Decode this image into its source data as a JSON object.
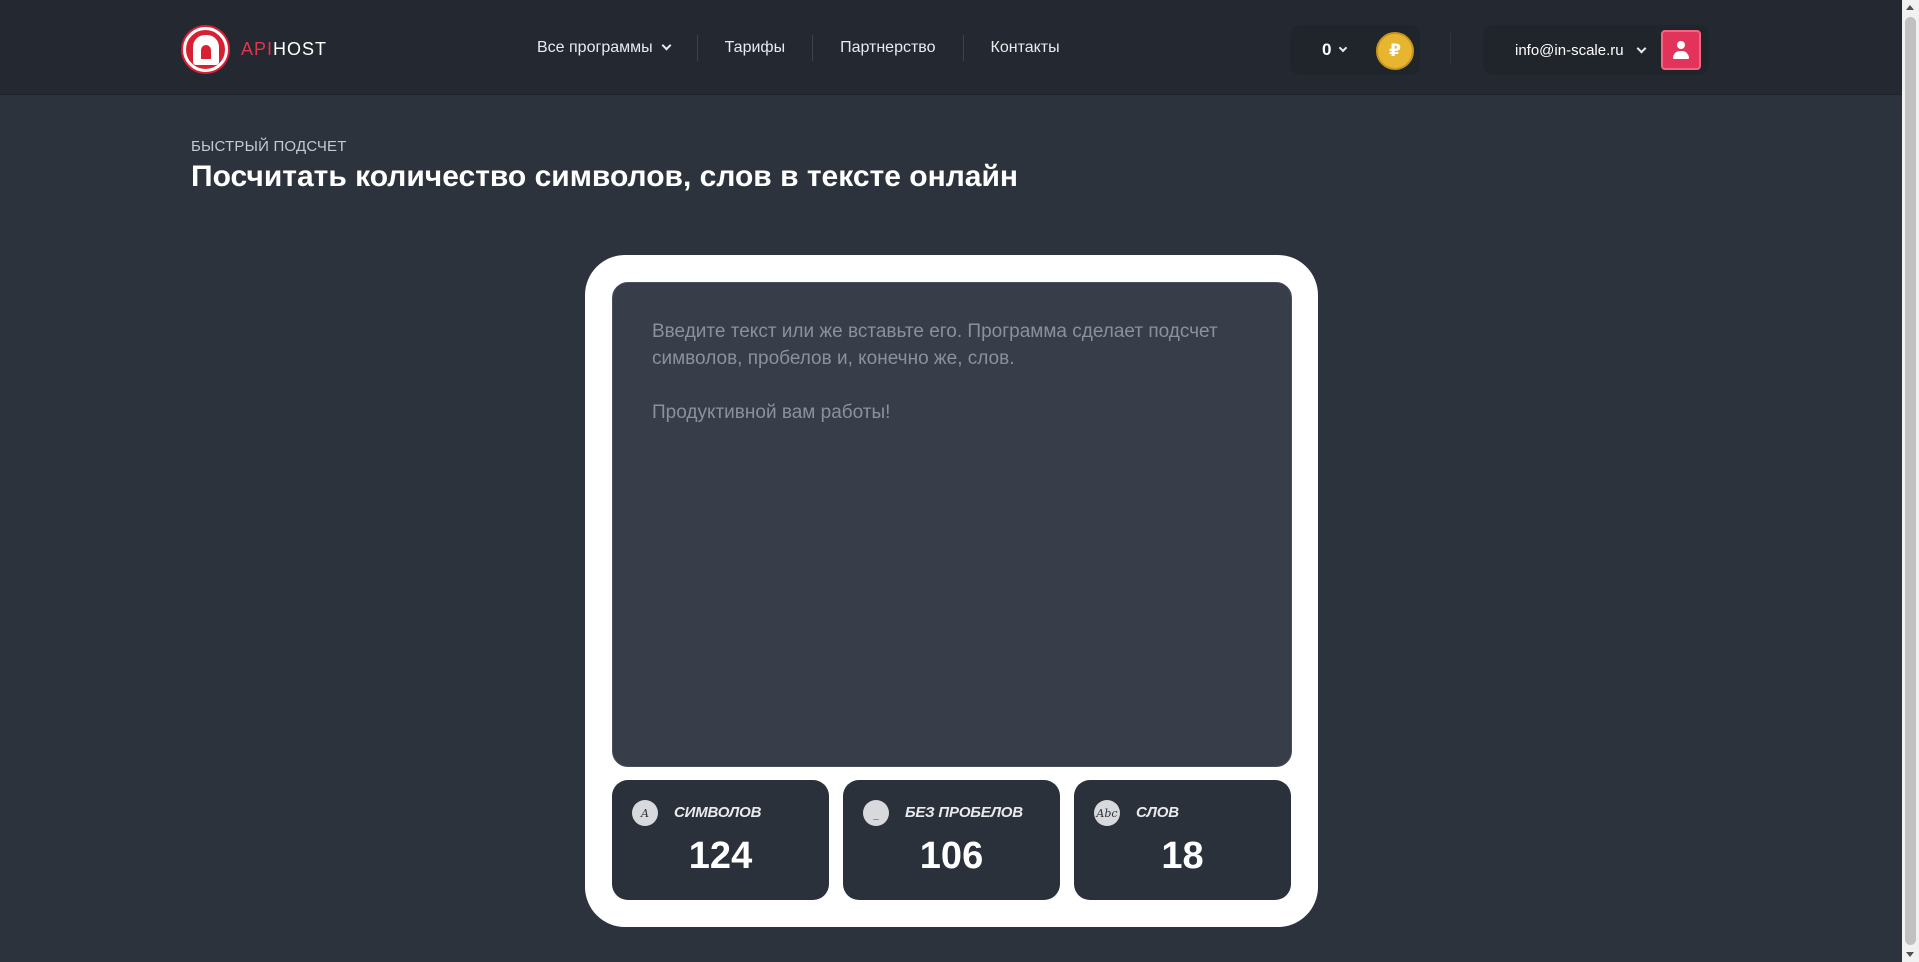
{
  "header": {
    "logo": {
      "part1": "API",
      "part2": "HOST"
    },
    "nav": [
      {
        "label": "Все программы",
        "has_dropdown": true
      },
      {
        "label": "Тарифы"
      },
      {
        "label": "Партнерство"
      },
      {
        "label": "Контакты"
      }
    ],
    "balance": {
      "value": "0",
      "currency_symbol": "₽"
    },
    "account": {
      "email": "info@in-scale.ru"
    }
  },
  "page": {
    "eyebrow": "БЫСТРЫЙ ПОДСЧЕТ",
    "title": "Посчитать количество символов, слов в тексте онлайн"
  },
  "counter": {
    "placeholder_line1": "Введите текст или же вставьте его. Программа сделает подсчет символов, пробелов и, конечно же, слов.",
    "placeholder_line2": "Продуктивной вам работы!",
    "stats": [
      {
        "icon": "A",
        "label": "СИМВОЛОВ",
        "value": "124"
      },
      {
        "icon": "_",
        "label": "БЕЗ ПРОБЕЛОВ",
        "value": "106"
      },
      {
        "icon": "Abc",
        "label": "СЛОВ",
        "value": "18"
      }
    ]
  },
  "colors": {
    "background": "#2d333d",
    "header": "#242931",
    "accent": "#e2345a",
    "coin": "#e7b52f"
  }
}
